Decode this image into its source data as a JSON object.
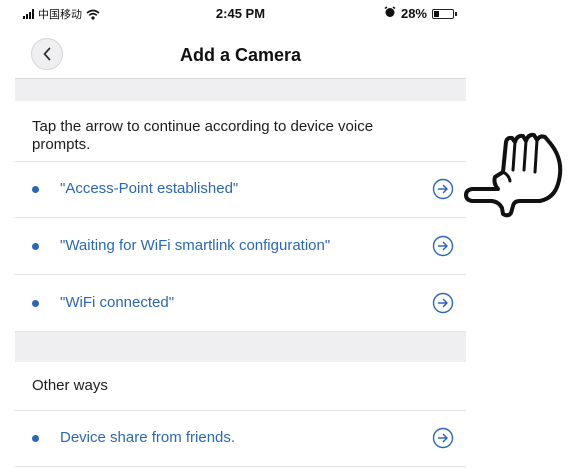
{
  "status_bar": {
    "carrier": "中国移动",
    "time": "2:45 PM",
    "battery": "28%"
  },
  "nav": {
    "title": "Add a Camera",
    "back_icon": "chevron-left-icon"
  },
  "intro": {
    "text": "Tap the arrow to continue according to device voice prompts."
  },
  "prompts": [
    {
      "label": "\"Access-Point established\"",
      "icon": "arrow-right-circle-icon"
    },
    {
      "label": "\"Waiting for WiFi smartlink configuration\"",
      "icon": "arrow-right-circle-icon"
    },
    {
      "label": "\"WiFi connected\"",
      "icon": "arrow-right-circle-icon"
    }
  ],
  "other_ways": {
    "heading": "Other ways",
    "items": [
      {
        "label": "Device share from friends.",
        "icon": "arrow-right-circle-icon"
      }
    ]
  },
  "colors": {
    "accent": "#2c67b6",
    "band": "#efeff2",
    "text": "#1c1c1c"
  }
}
